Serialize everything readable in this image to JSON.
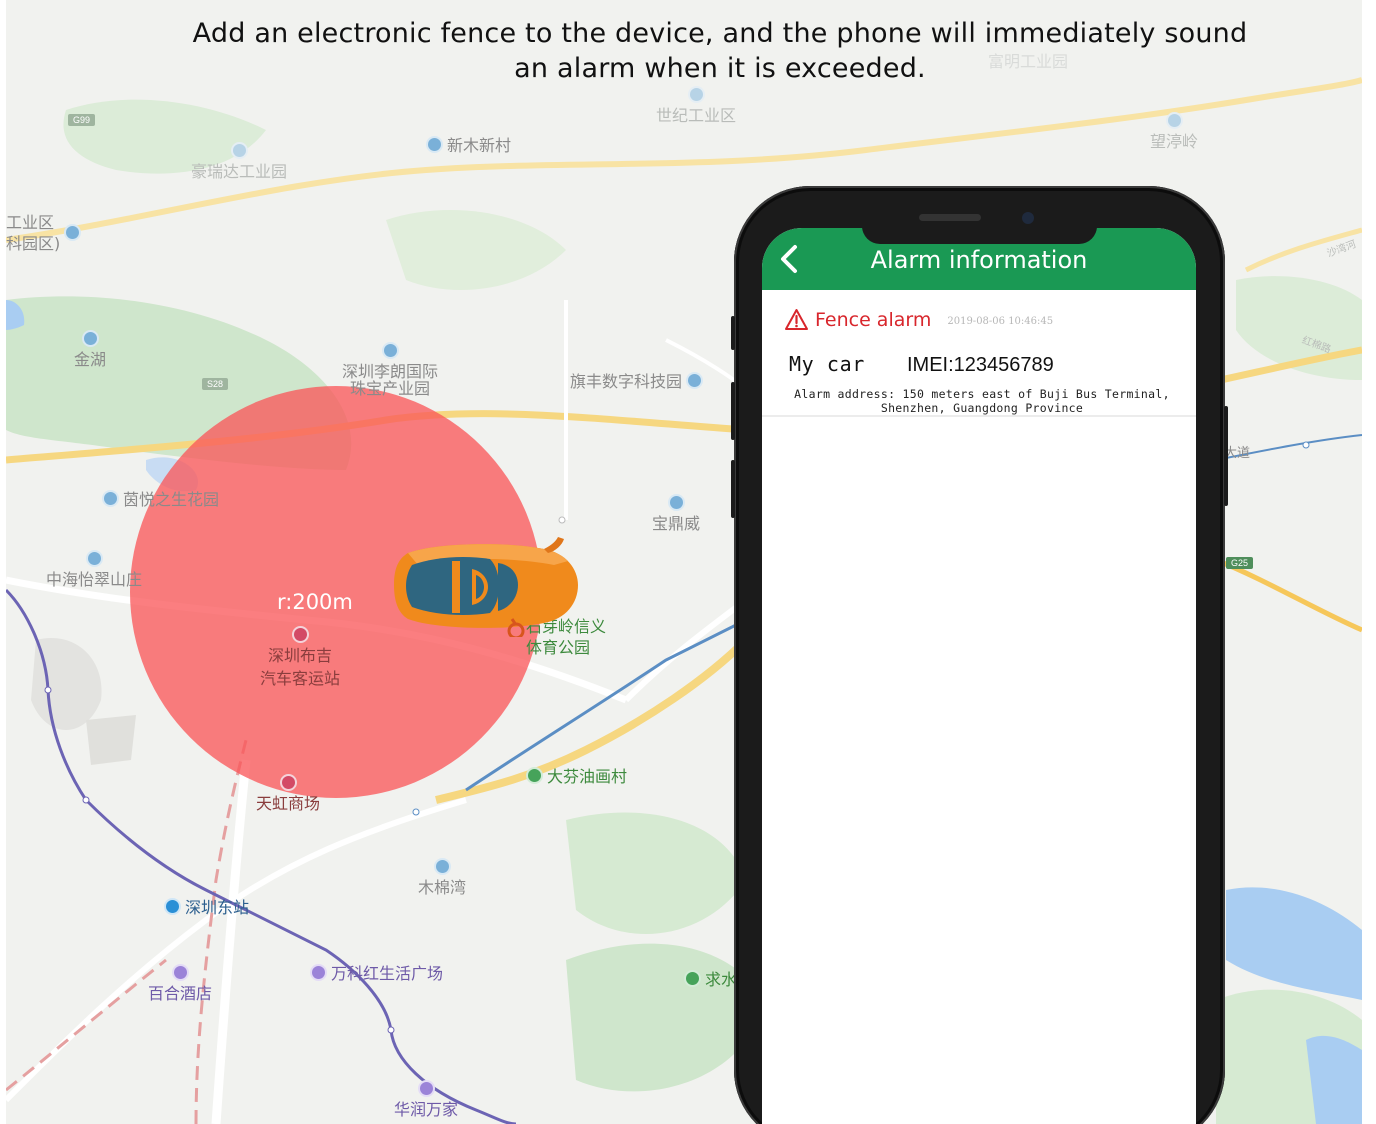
{
  "headline": {
    "line1": "Add an electronic fence to the device, and the phone will immediately sound",
    "line2": "an alarm when it is exceeded."
  },
  "colors": {
    "fence": "#fa5558",
    "app_bar": "#1a9954",
    "alarm_red": "#d8262c",
    "car_body": "#f08a1c",
    "car_glass": "#2f6680"
  },
  "icons": {
    "back": "chevron-left-icon",
    "alarm": "warning-triangle-icon",
    "poi": "map-pin-icon",
    "car": "car-icon"
  },
  "map": {
    "fence_radius_label": "r:200m",
    "road_badges": [
      "G99",
      "S28",
      "G25"
    ],
    "pois": [
      {
        "id": "xinmu",
        "label": "新木新村"
      },
      {
        "id": "shiji",
        "label": "世纪工业区"
      },
      {
        "id": "haorui",
        "label": "豪瑞达工业园"
      },
      {
        "id": "wangting",
        "label": "望渟岭"
      },
      {
        "id": "jinhu",
        "label": "金湖"
      },
      {
        "id": "gongye",
        "label_1": "工业区",
        "label_2": "科园区)"
      },
      {
        "id": "liulang",
        "label_1": "深圳李朗国际",
        "label_2": "珠宝产业园"
      },
      {
        "id": "qifeng",
        "label": "旗丰数字科技园"
      },
      {
        "id": "yinyue",
        "label": "茵悦之生花园"
      },
      {
        "id": "baoding",
        "label": "宝鼎威"
      },
      {
        "id": "zhonghai",
        "label": "中海怡翠山庄"
      },
      {
        "id": "shiyaling",
        "label_1": "石芽岭信义",
        "label_2": "体育公园"
      },
      {
        "id": "bujistation",
        "label_1": "深圳布吉",
        "label_2": "汽车客运站"
      },
      {
        "id": "dafen",
        "label": "大芬油画村"
      },
      {
        "id": "tianhong",
        "label": "天虹商场"
      },
      {
        "id": "mumianwan",
        "label": "木棉湾"
      },
      {
        "id": "dongzhan",
        "label": "深圳东站"
      },
      {
        "id": "wanke",
        "label": "万科红生活广场"
      },
      {
        "id": "baihe",
        "label": "百合酒店"
      },
      {
        "id": "qiushui",
        "label": "求水"
      },
      {
        "id": "huarun",
        "label": "华润万家"
      },
      {
        "id": "fumin",
        "label": "富明工业园"
      },
      {
        "id": "dadao",
        "label": "大道"
      },
      {
        "id": "hongmiandao",
        "label": "红棉路"
      },
      {
        "id": "shahu",
        "label": "沙湾河"
      }
    ]
  },
  "phone": {
    "app_title": "Alarm information",
    "alarm": {
      "type_label": "Fence alarm",
      "timestamp": "2019-08-06 10:46:45",
      "device_name": "My car",
      "imei": "IMEI:123456789",
      "address_line1": "Alarm address: 150 meters east of Buji Bus Terminal,",
      "address_line2": "Shenzhen, Guangdong Province"
    }
  }
}
